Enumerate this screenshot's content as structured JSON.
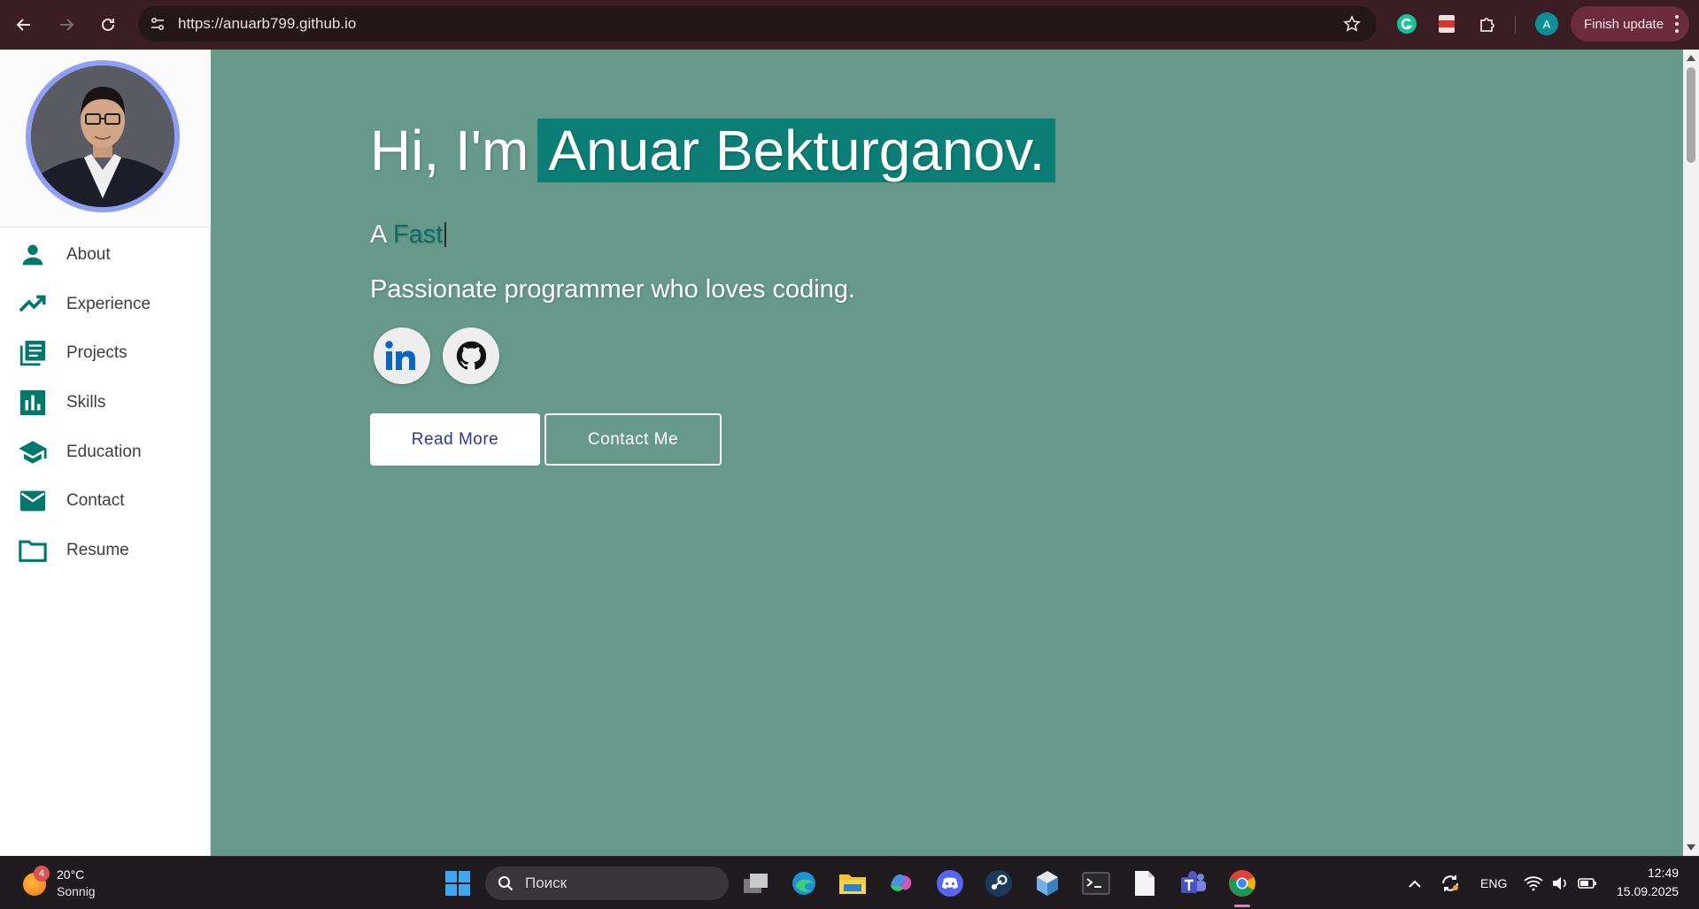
{
  "browser": {
    "url": "https://anuarb799.github.io",
    "profile_initial": "A",
    "update_label": "Finish update"
  },
  "sidebar": {
    "items": [
      {
        "label": "About",
        "icon": "person-icon"
      },
      {
        "label": "Experience",
        "icon": "trending-up-icon"
      },
      {
        "label": "Projects",
        "icon": "library-books-icon"
      },
      {
        "label": "Skills",
        "icon": "bar-chart-icon"
      },
      {
        "label": "Education",
        "icon": "school-icon"
      },
      {
        "label": "Contact",
        "icon": "mail-icon"
      },
      {
        "label": "Resume",
        "icon": "folder-icon"
      }
    ]
  },
  "hero": {
    "greeting": "Hi, I'm",
    "name": "Anuar Bekturganov.",
    "typed_prefix": "A",
    "typed_word": "Fast",
    "tagline": "Passionate programmer who loves coding.",
    "read_more": "Read More",
    "contact_me": "Contact Me"
  },
  "taskbar": {
    "weather_badge": "4",
    "temperature": "20°C",
    "condition": "Sonnig",
    "search_placeholder": "Поиск",
    "language": "ENG",
    "time": "12:49",
    "date": "15.09.2025"
  },
  "colors": {
    "page_bg": "#66998a",
    "accent": "#0b7f76",
    "sidebar_icon": "#00796b",
    "avatar_ring": "#8f9ff5",
    "chrome_bg": "#3b1e24"
  }
}
